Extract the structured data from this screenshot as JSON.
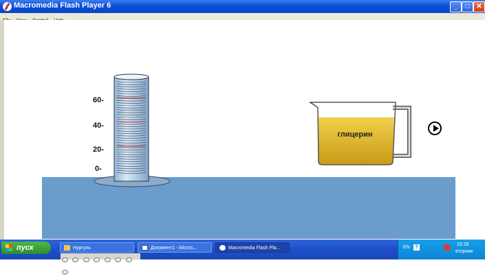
{
  "window": {
    "title": "Macromedia Flash Player 6",
    "buttons": {
      "minimize": "_",
      "maximize": "□",
      "close": "✕"
    }
  },
  "menu": [
    "File",
    "View",
    "Control",
    "Help"
  ],
  "cylinder": {
    "scale_labels": [
      "60-",
      "40-",
      "20-",
      "0-"
    ],
    "marks": [
      0,
      20,
      40,
      60
    ]
  },
  "beaker": {
    "label": "глицерин",
    "color": "#e2b930"
  },
  "water_color": "#6a9ccc",
  "play_icon": "play-circle-icon",
  "taskbar": {
    "start_label": "пуск",
    "tasks": [
      {
        "label": "Нургуль",
        "icon": "folder-icon",
        "active": false
      },
      {
        "label": "Документ1 - Micros...",
        "icon": "word-icon",
        "active": false
      },
      {
        "label": "Macromedia Flash Pla...",
        "icon": "flash-icon",
        "active": true
      }
    ],
    "tray": {
      "language": "EN",
      "help_icon": "?",
      "time": "15:26",
      "day": "вторник"
    }
  }
}
